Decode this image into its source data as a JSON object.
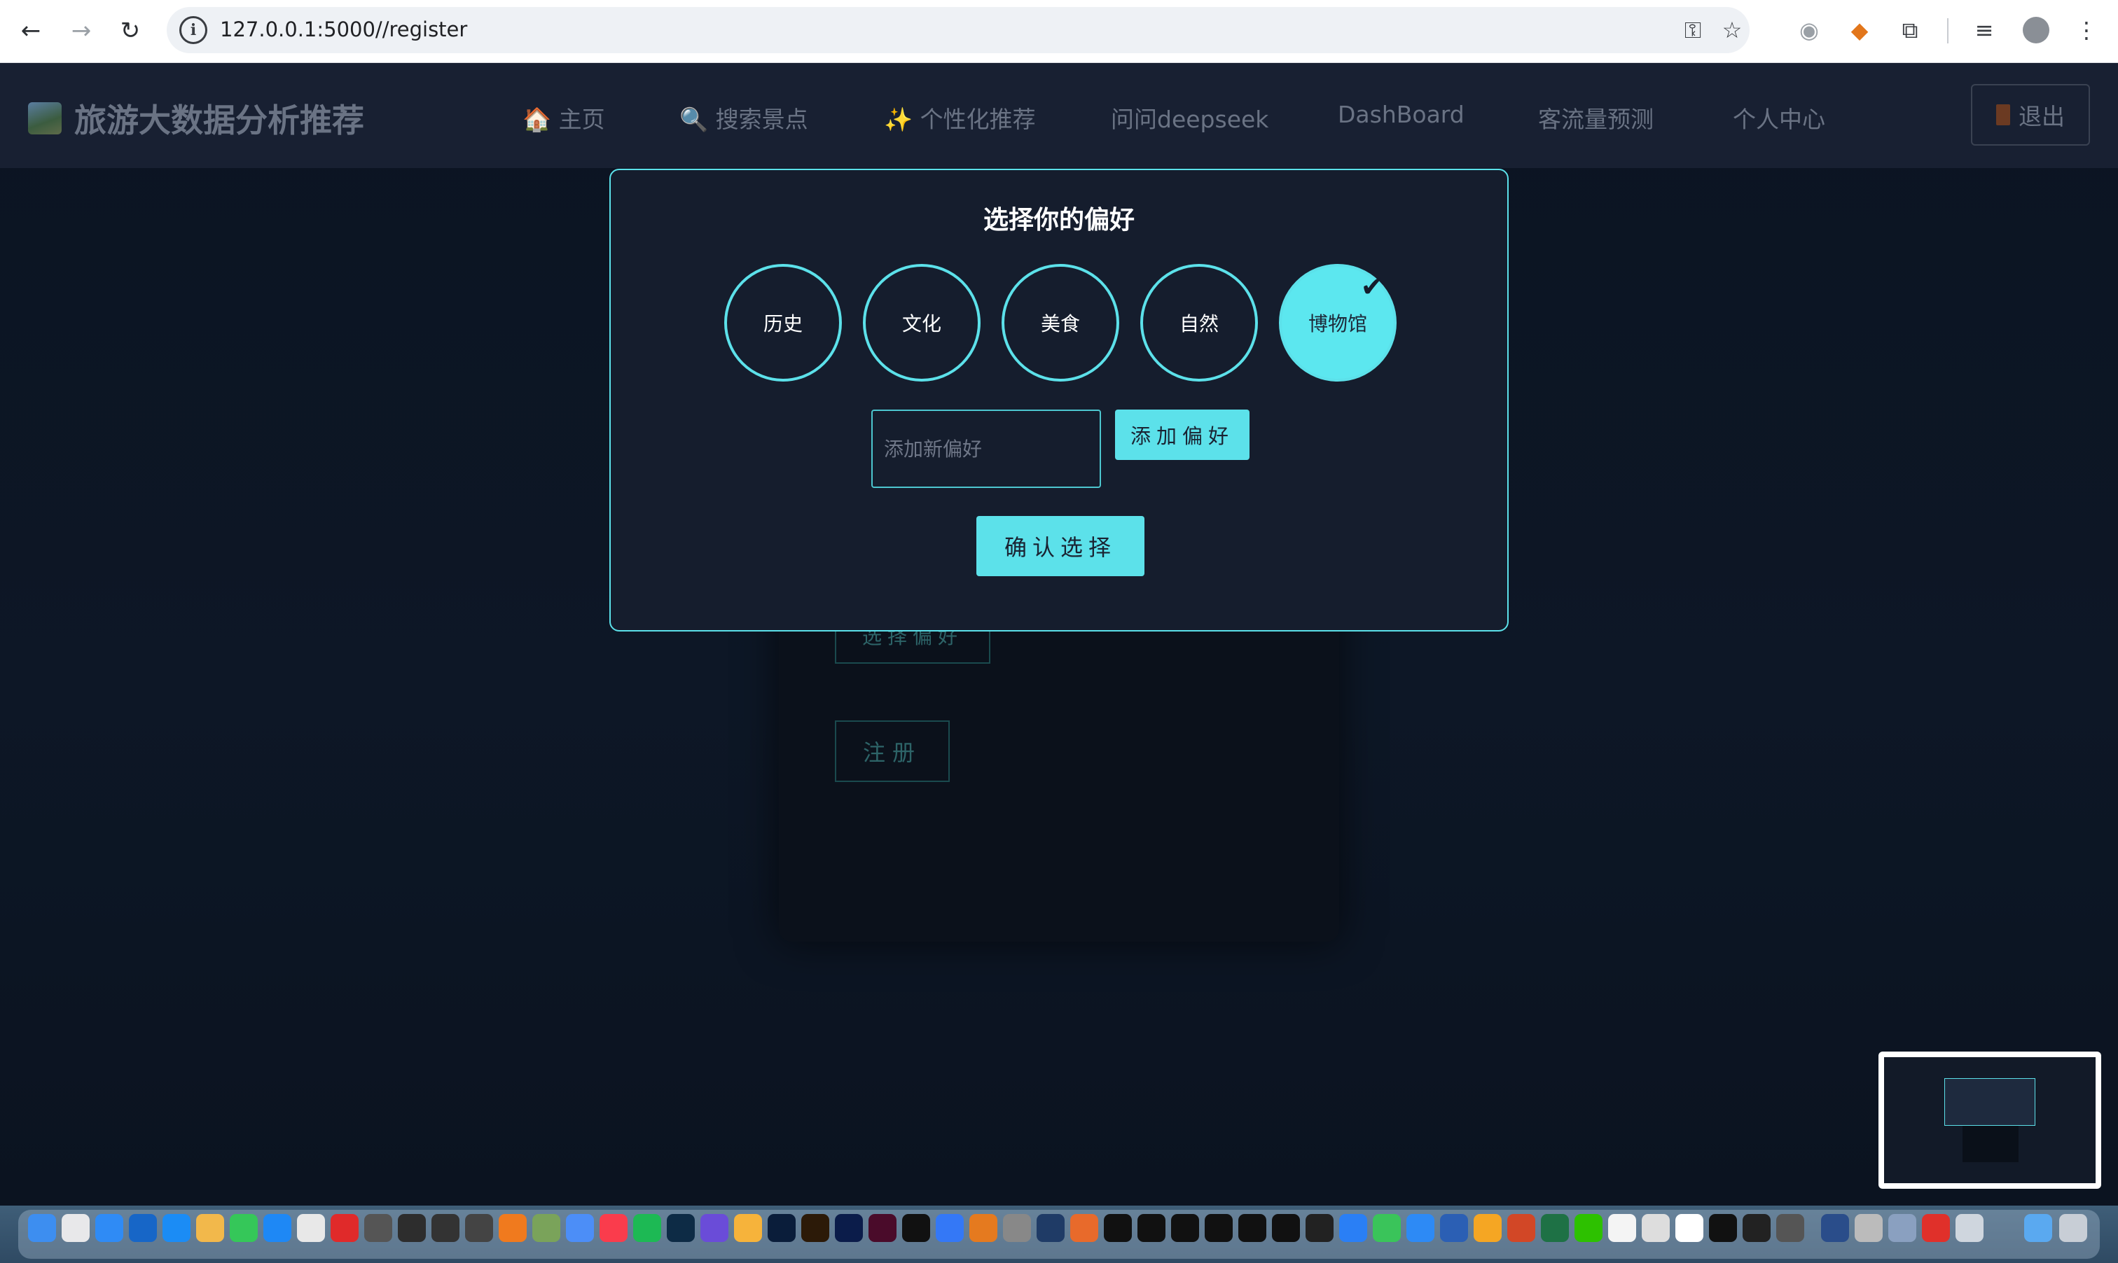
{
  "browser": {
    "url": "127.0.0.1:5000//register",
    "back_icon": "back-arrow-icon",
    "forward_icon": "forward-arrow-icon",
    "reload_icon": "reload-icon"
  },
  "site": {
    "brand": "旅游大数据分析推荐",
    "nav": [
      "🏠 主页",
      "🔍 搜索景点",
      "✨ 个性化推荐",
      "问问deepseek",
      "DashBoard",
      "客流量预测",
      "个人中心"
    ],
    "logout": "退出",
    "bg_buttons": {
      "choose_pref": "选择偏好",
      "register": "注册"
    }
  },
  "modal": {
    "title": "选择你的偏好",
    "preferences": [
      {
        "label": "历史",
        "selected": false
      },
      {
        "label": "文化",
        "selected": false
      },
      {
        "label": "美食",
        "selected": false
      },
      {
        "label": "自然",
        "selected": false
      },
      {
        "label": "博物馆",
        "selected": true
      }
    ],
    "check_mark": "✔",
    "input_placeholder": "添加新偏好",
    "add_button": "添加偏好",
    "confirm_button": "确认选择"
  },
  "colors": {
    "accent": "#5ce1ea",
    "modal_bg": "#151d2d",
    "page_bg": "#0e1522"
  }
}
